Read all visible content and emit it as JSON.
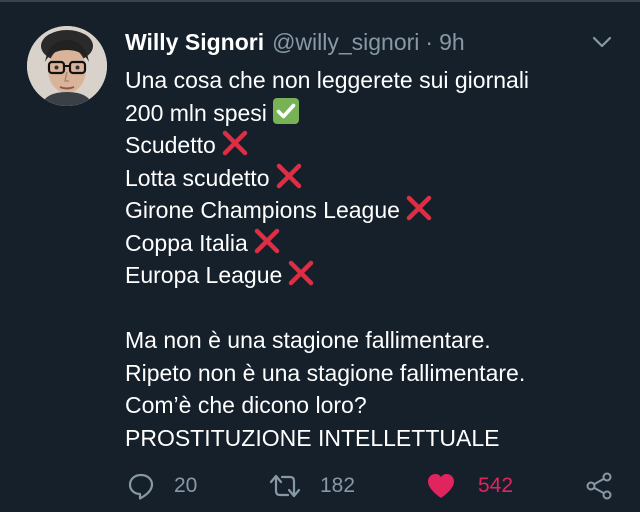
{
  "author": {
    "display_name": "Willy Signori",
    "handle": "@willy_signori",
    "separator": "·",
    "time": "9h"
  },
  "tweet": {
    "lines": [
      {
        "text": "Una cosa che non leggerete sui giornali",
        "emoji": null
      },
      {
        "text": "200 mln spesi",
        "emoji": "check-mark-icon"
      },
      {
        "text": "Scudetto",
        "emoji": "cross-mark-icon"
      },
      {
        "text": "Lotta scudetto",
        "emoji": "cross-mark-icon"
      },
      {
        "text": "Girone Champions League",
        "emoji": "cross-mark-icon"
      },
      {
        "text": "Coppa Italia",
        "emoji": "cross-mark-icon"
      },
      {
        "text": "Europa League",
        "emoji": "cross-mark-icon"
      },
      {
        "text": "",
        "emoji": null
      },
      {
        "text": "Ma non è una stagione fallimentare.",
        "emoji": null
      },
      {
        "text": "Ripeto non è una stagione fallimentare.",
        "emoji": null
      },
      {
        "text": "Com’è che dicono loro?",
        "emoji": null
      },
      {
        "text": "PROSTITUZIONE INTELLETTUALE",
        "emoji": null
      }
    ]
  },
  "actions": {
    "replies": "20",
    "retweets": "182",
    "likes": "542"
  },
  "icons": {
    "menu": "chevron-down-icon",
    "reply": "reply-icon",
    "retweet": "retweet-icon",
    "like": "heart-icon",
    "share": "share-icon"
  },
  "colors": {
    "background": "#15202b",
    "secondary_text": "#8899a6",
    "like_active": "#e0245e",
    "check_green": "#77b255",
    "cross_red": "#dd2e44"
  }
}
